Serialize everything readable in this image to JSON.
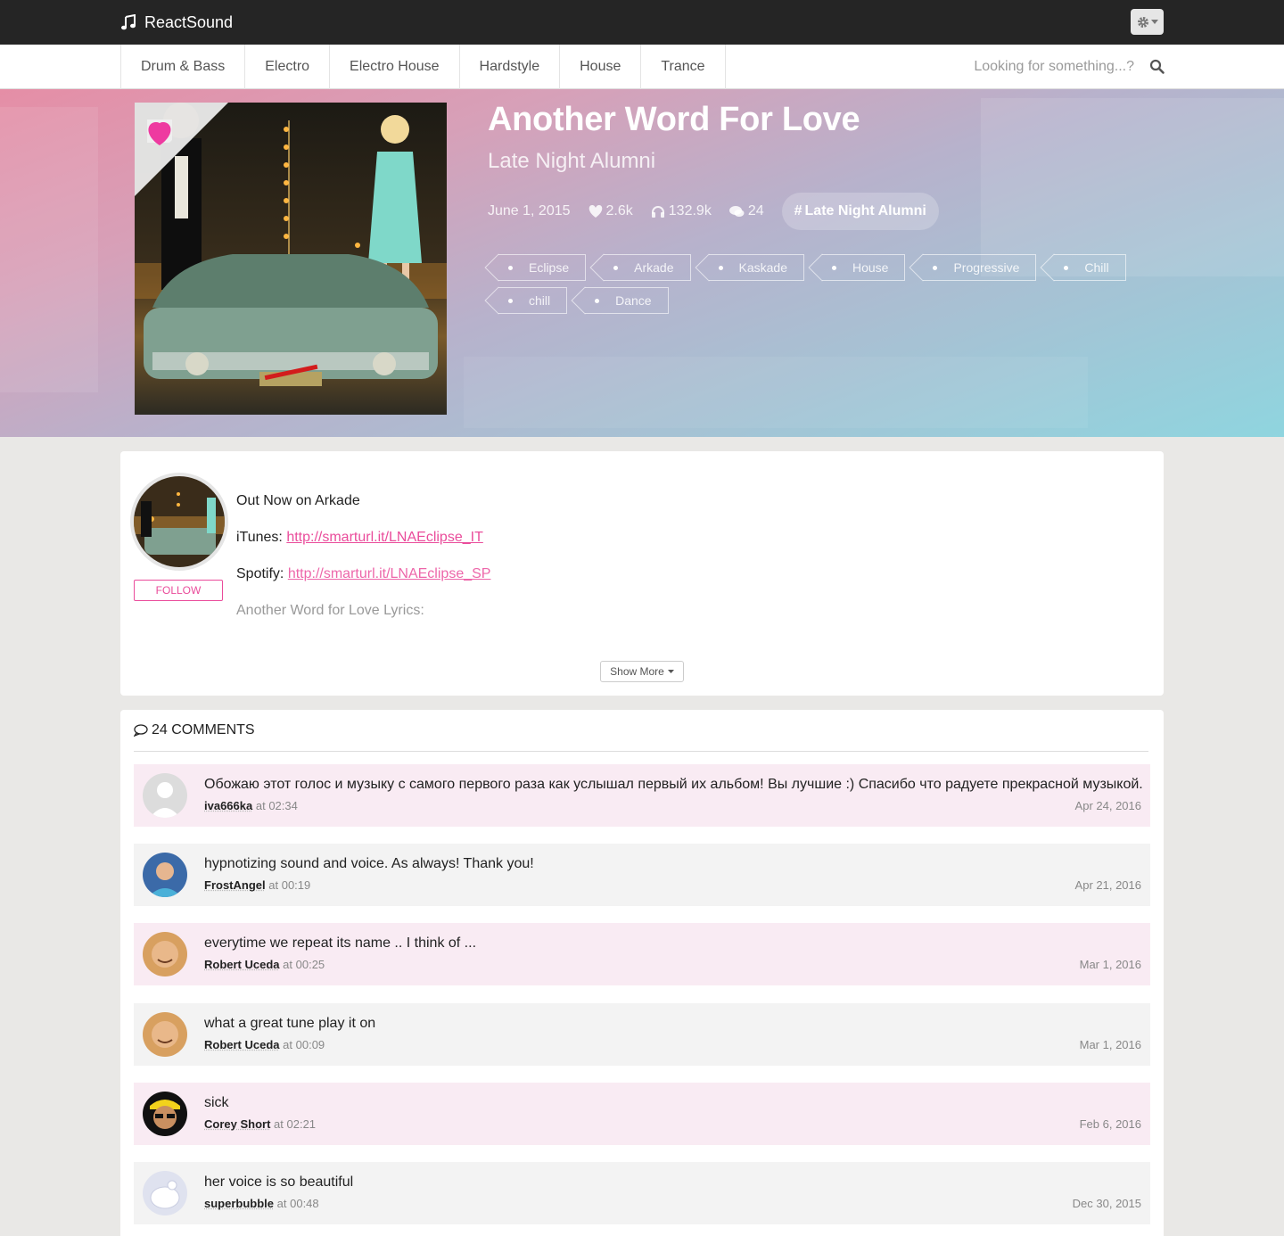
{
  "app": {
    "name": "ReactSound"
  },
  "nav": {
    "genres": [
      "Drum & Bass",
      "Electro",
      "Electro House",
      "Hardstyle",
      "House",
      "Trance"
    ],
    "search_placeholder": "Looking for something...?"
  },
  "track": {
    "title": "Another Word For Love",
    "artist": "Late Night Alumni",
    "date": "June 1, 2015",
    "likes": "2.6k",
    "plays": "132.9k",
    "comments_count": "24",
    "artist_pill": "Late Night Alumni",
    "tags": [
      "Eclipse",
      "Arkade",
      "Kaskade",
      "House",
      "Progressive",
      "Chill",
      "chill",
      "Dance"
    ],
    "liked": true
  },
  "description": {
    "follow_label": "FOLLOW",
    "line1": "Out Now on Arkade",
    "itunes_label": "iTunes: ",
    "itunes_link": "http://smarturl.it/LNAEclipse_IT",
    "spotify_label": "Spotify: ",
    "spotify_link": "http://smarturl.it/LNAEclipse_SP",
    "line4": "Another Word for Love Lyrics:",
    "show_more": "Show More"
  },
  "comments": {
    "header": "24 COMMENTS",
    "at": "at",
    "items": [
      {
        "text": "Обожаю этот голос и музыку с самого первого раза как услышал первый их альбом! Вы лучшие :) Спасибо что радуете прекрасной музыкой.",
        "user": "iva666ka",
        "time": "02:34",
        "date": "Apr 24, 2016"
      },
      {
        "text": "hypnotizing sound and voice. As always! Thank you!",
        "user": "FrostAngel",
        "time": "00:19",
        "date": "Apr 21, 2016"
      },
      {
        "text": "everytime we repeat its name .. I think of ...",
        "user": "Robert Uceda",
        "time": "00:25",
        "date": "Mar 1, 2016"
      },
      {
        "text": "what a great tune play it on",
        "user": "Robert Uceda",
        "time": "00:09",
        "date": "Mar 1, 2016"
      },
      {
        "text": "sick",
        "user": "Corey Short",
        "time": "02:21",
        "date": "Feb 6, 2016"
      },
      {
        "text": "her voice is so beautiful",
        "user": "superbubble",
        "time": "00:48",
        "date": "Dec 30, 2015"
      }
    ]
  },
  "colors": {
    "accent": "#ea4c9b",
    "topbar": "#252525"
  },
  "icons": [
    "music-note-icon",
    "gear-icon",
    "search-icon",
    "heart-icon",
    "headphones-icon",
    "comments-icon",
    "hash-icon",
    "tag-icon",
    "caret-down-icon"
  ]
}
